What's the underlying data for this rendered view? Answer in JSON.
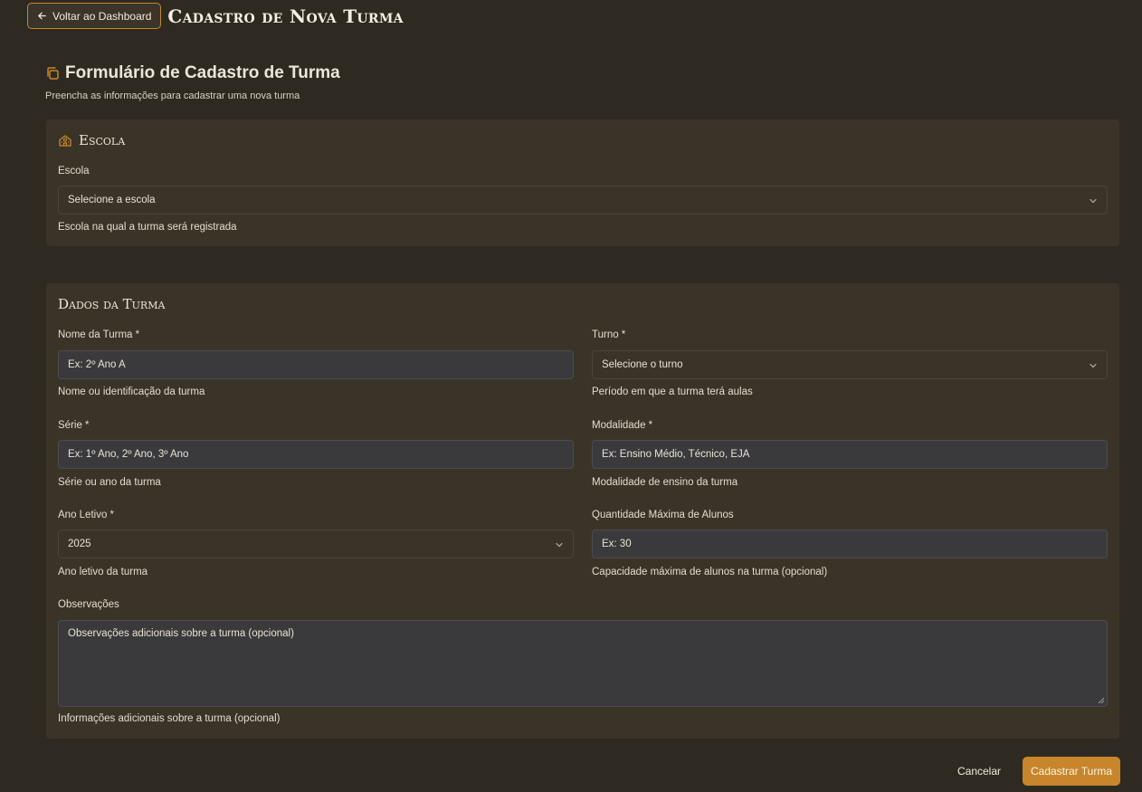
{
  "header": {
    "back_label": "Voltar ao Dashboard",
    "title": "Cadastro de Nova Turma"
  },
  "form": {
    "title": "Formulário de Cadastro de Turma",
    "subtitle": "Preencha as informações para cadastrar uma nova turma"
  },
  "escola_section": {
    "title": "Escola",
    "escola_label": "Escola",
    "escola_placeholder": "Selecione a escola",
    "escola_hint": "Escola na qual a turma será registrada"
  },
  "dados_section": {
    "title": "Dados da Turma",
    "nome_label": "Nome da Turma *",
    "nome_placeholder": "Ex: 2º Ano A",
    "nome_hint": "Nome ou identificação da turma",
    "turno_label": "Turno *",
    "turno_placeholder": "Selecione o turno",
    "turno_hint": "Período em que a turma terá aulas",
    "serie_label": "Série *",
    "serie_placeholder": "Ex: 1º Ano, 2º Ano, 3º Ano",
    "serie_hint": "Série ou ano da turma",
    "modalidade_label": "Modalidade *",
    "modalidade_placeholder": "Ex: Ensino Médio, Técnico, EJA",
    "modalidade_hint": "Modalidade de ensino da turma",
    "ano_label": "Ano Letivo *",
    "ano_value": "2025",
    "ano_hint": "Ano letivo da turma",
    "qtd_label": "Quantidade Máxima de Alunos",
    "qtd_placeholder": "Ex: 30",
    "qtd_hint": "Capacidade máxima de alunos na turma (opcional)",
    "obs_label": "Observações",
    "obs_placeholder": "Observações adicionais sobre a turma (opcional)",
    "obs_hint": "Informações adicionais sobre a turma (opcional)"
  },
  "footer": {
    "cancel_label": "Cancelar",
    "submit_label": "Cadastrar Turma"
  },
  "colors": {
    "background": "#2e2a22",
    "card": "#3a3428",
    "accent": "#c7862b",
    "input": "#3a3a3c"
  },
  "icons": {
    "back": "arrow-left-icon",
    "form": "copy-icon",
    "escola": "school-icon",
    "select": "chevron-down-icon"
  }
}
